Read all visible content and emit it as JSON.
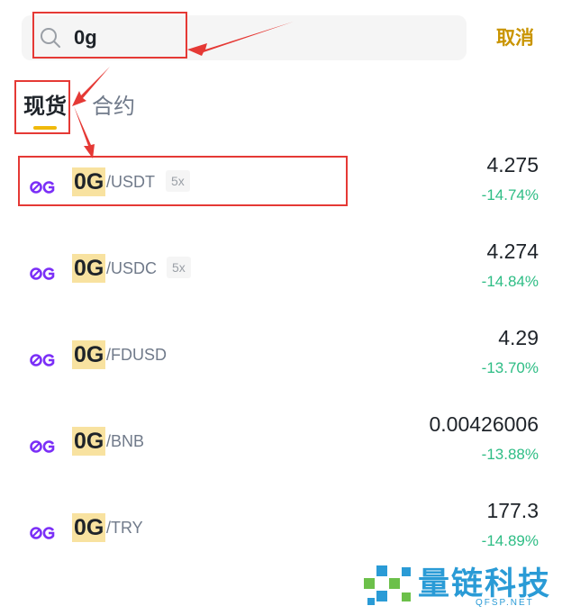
{
  "search": {
    "value": "0g"
  },
  "cancel_label": "取消",
  "tabs": [
    {
      "label": "现货",
      "active": true
    },
    {
      "label": "合约",
      "active": false
    }
  ],
  "pairs": [
    {
      "base": "0G",
      "quote": "/USDT",
      "leverage": "5x",
      "price": "4.275",
      "change": "-14.74%"
    },
    {
      "base": "0G",
      "quote": "/USDC",
      "leverage": "5x",
      "price": "4.274",
      "change": "-14.84%"
    },
    {
      "base": "0G",
      "quote": "/FDUSD",
      "leverage": "",
      "price": "4.29",
      "change": "-13.70%"
    },
    {
      "base": "0G",
      "quote": "/BNB",
      "leverage": "",
      "price": "0.00426006",
      "change": "-13.88%"
    },
    {
      "base": "0G",
      "quote": "/TRY",
      "leverage": "",
      "price": "177.3",
      "change": "-14.89%"
    }
  ],
  "watermark": {
    "text": "量链科技",
    "sub": "QFSP.NET"
  },
  "colors": {
    "accent": "#f0b90b",
    "cancel": "#c99400",
    "positive_change": "#2ebd85",
    "logo": "#7b2ff7",
    "annotation": "#e53935"
  },
  "icons": {
    "search": "search-icon",
    "coin": "0g-coin-logo"
  }
}
